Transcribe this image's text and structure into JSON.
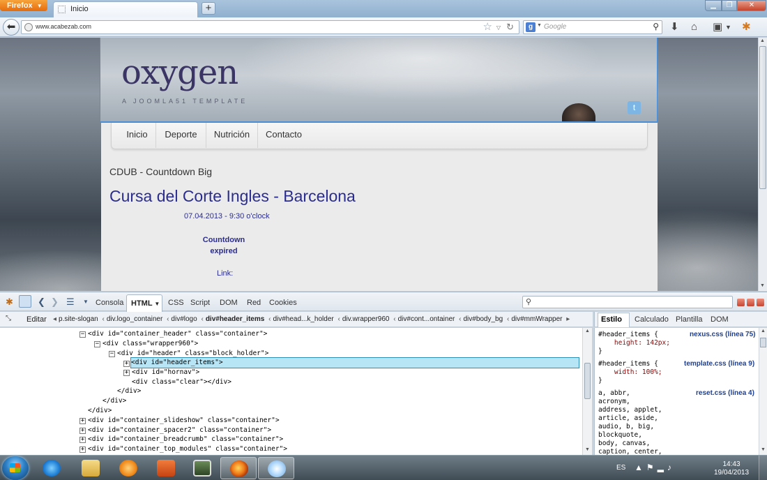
{
  "browser": {
    "app_button": "Firefox",
    "tab_title": "Inicio",
    "url": "www.acabezab.com",
    "search_engine_letter": "g",
    "search_placeholder": "Google"
  },
  "site": {
    "logo": "oxygen",
    "slogan": "A JOOMLA51 TEMPLATE",
    "menu": [
      "Inicio",
      "Deporte",
      "Nutrición",
      "Contacto"
    ],
    "module_title": "CDUB - Countdown Big",
    "event_title": "Cursa del Corte Ingles - Barcelona",
    "event_date": "07.04.2013 - 9:30 o'clock",
    "countdown_line1": "Countdown",
    "countdown_line2": "expired",
    "link_label": "Link:"
  },
  "firebug": {
    "tabs": [
      "Consola",
      "HTML",
      "CSS",
      "Script",
      "DOM",
      "Red",
      "Cookies"
    ],
    "edit_label": "Editar",
    "breadcrumb": [
      "p.site-slogan",
      "div.logo_container",
      "div#logo",
      "div#header_items",
      "div#head...k_holder",
      "div.wrapper960",
      "div#cont...ontainer",
      "div#body_bg",
      "div#mmWrapper"
    ],
    "side_tabs": [
      "Estilo",
      "Calculado",
      "Plantilla",
      "DOM"
    ],
    "html_lines": [
      "<div id=\"container_header\" class=\"container\">",
      "<div class=\"wrapper960\">",
      "<div id=\"header\" class=\"block_holder\">",
      "<div id=\"header_items\">",
      "<div id=\"hornav\">",
      "<div class=\"clear\"></div>",
      "</div>",
      "</div>",
      "</div>",
      "<div id=\"container_slideshow\" class=\"container\">",
      "<div id=\"container_spacer2\" class=\"container\">",
      "<div id=\"container_breadcrumb\" class=\"container\">",
      "<div id=\"container_top_modules\" class=\"container\">"
    ],
    "style_rules": [
      {
        "selector": "#header_items {",
        "prop": "    height: 142px;",
        "close": "}",
        "source": "nexus.css (línea 75)"
      },
      {
        "selector": "#header_items {",
        "prop": "    width: 100%;",
        "close": "}",
        "source": "template.css (línea 9)"
      },
      {
        "selector": "a, abbr,",
        "more": [
          "acronym,",
          "address, applet,",
          "article, aside,",
          "audio, b, big,",
          "blockquote,",
          "body, canvas,",
          "caption, center,"
        ],
        "source": "reset.css (línea 4)"
      }
    ]
  },
  "taskbar": {
    "language": "ES",
    "time": "14:43",
    "date": "19/04/2013"
  }
}
